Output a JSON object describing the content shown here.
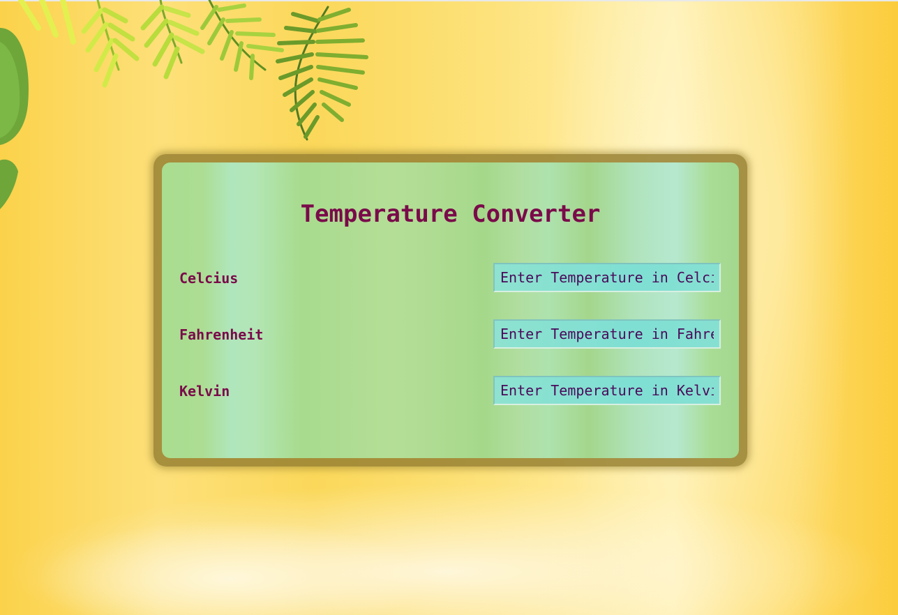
{
  "title": "Temperature Converter",
  "fields": [
    {
      "label": "Celcius",
      "placeholder": "Enter Temperature in Celcius",
      "value": ""
    },
    {
      "label": "Fahrenheit",
      "placeholder": "Enter Temperature in Fahrenheit",
      "value": ""
    },
    {
      "label": "Kelvin",
      "placeholder": "Enter Temperature in Kelvin",
      "value": ""
    }
  ],
  "colors": {
    "title_text": "#7a0a4a",
    "label_text": "#7a0a4a",
    "input_text": "#4a0a5a",
    "input_background": "#7fdfd3",
    "card_background": "#acdb90",
    "card_frame": "#968032",
    "page_background": "#fbd85a"
  }
}
